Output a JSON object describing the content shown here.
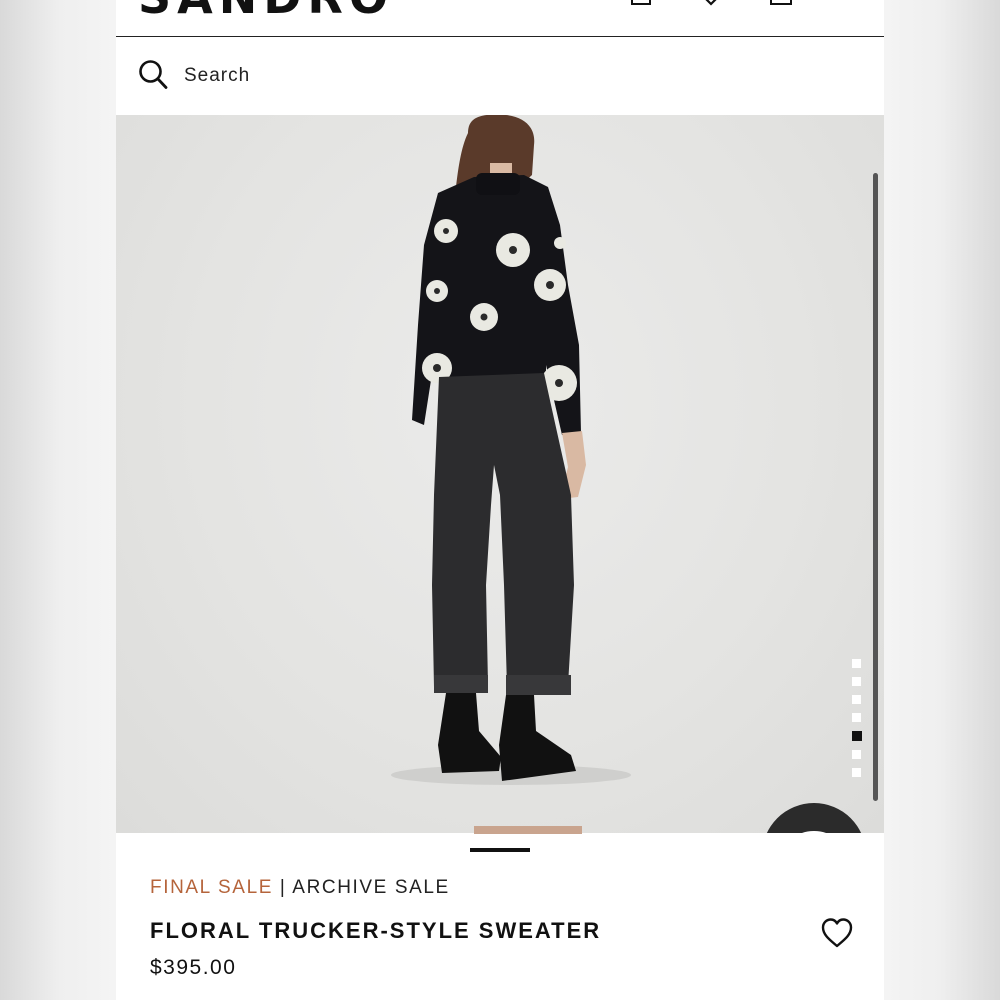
{
  "header": {
    "logo": "SANDRO",
    "icons": [
      "account-icon",
      "wishlist-icon",
      "bag-icon"
    ]
  },
  "search": {
    "label": "Search",
    "icon": "search-icon"
  },
  "gallery": {
    "image_count": 7,
    "active_index": 5,
    "chat_icon": "chat-icon"
  },
  "product": {
    "sale_tag": "FINAL SALE",
    "separator": "|",
    "collection": "ARCHIVE SALE",
    "name": "FLORAL TRUCKER-STYLE SWEATER",
    "price": "$395.00",
    "wishlist_icon": "heart-icon"
  },
  "colors": {
    "sale_accent": "#b5643b",
    "text": "#111111",
    "chat_bg": "#2b2b2b",
    "photo_bg": "#e4e4e2"
  }
}
